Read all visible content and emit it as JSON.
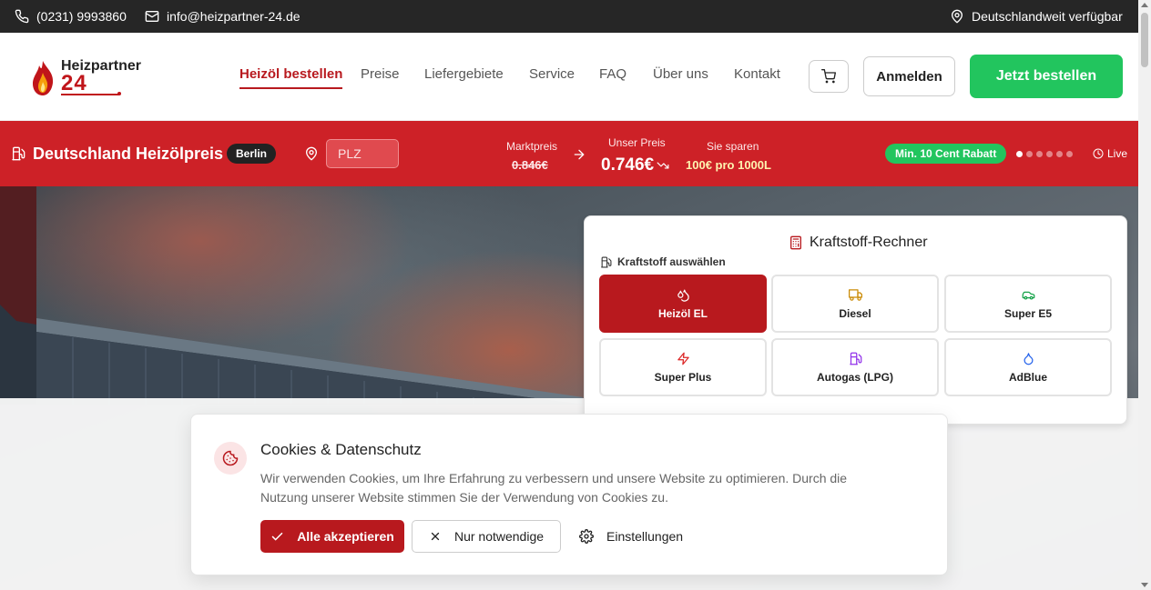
{
  "topbar": {
    "phone": "(0231) 9993860",
    "email": "info@heizpartner-24.de",
    "availability": "Deutschlandweit verfügbar"
  },
  "logo": {
    "name": "Heizpartner",
    "number": "24"
  },
  "nav": {
    "items": [
      "Heizöl bestellen",
      "Preise",
      "Liefergebiete",
      "Service",
      "FAQ",
      "Über uns",
      "Kontakt"
    ],
    "active_index": 0
  },
  "header_actions": {
    "login": "Anmelden",
    "order": "Jetzt bestellen"
  },
  "pricebar": {
    "title": "Deutschland Heizölpreis",
    "city": "Berlin",
    "plz_placeholder": "PLZ",
    "market_label": "Marktpreis",
    "market_price": "0.846€",
    "our_label": "Unser Preis",
    "our_price": "0.746€",
    "save_label": "Sie sparen",
    "save_value": "100€ pro 1000L",
    "discount_badge": "Min. 10 Cent Rabatt",
    "live_label": "Live",
    "slides_total": 6,
    "slide_active": 1
  },
  "calculator": {
    "title": "Kraftstoff-Rechner",
    "select_label": "Kraftstoff auswählen",
    "fuels": [
      "Heizöl EL",
      "Diesel",
      "Super E5",
      "Super Plus",
      "Autogas (LPG)",
      "AdBlue"
    ],
    "selected_index": 0,
    "icon_colors": [
      "#b8191e",
      "#ca8a04",
      "#16a34a",
      "#dc2626",
      "#9333ea",
      "#2563eb"
    ]
  },
  "cookie": {
    "title": "Cookies & Datenschutz",
    "text": "Wir verwenden Cookies, um Ihre Erfahrung zu verbessern und unsere Website zu optimieren. Durch die Nutzung unserer Website stimmen Sie der Verwendung von Cookies zu.",
    "accept_all": "Alle akzeptieren",
    "necessary_only": "Nur notwendige",
    "settings": "Einstellungen"
  },
  "colors": {
    "brand_red": "#cd2127",
    "dark_red": "#b8191e",
    "green": "#22c55e",
    "topbar": "#262626"
  },
  "icons": [
    "phone-icon",
    "mail-icon",
    "map-pin-icon",
    "flame-icon",
    "cart-icon",
    "fuel-pump-icon",
    "location-icon",
    "arrow-right-icon",
    "trending-down-icon",
    "clock-icon",
    "calculator-icon",
    "droplets-icon",
    "truck-icon",
    "car-icon",
    "zap-icon",
    "droplet-icon",
    "cookie-icon",
    "check-icon",
    "x-icon",
    "gear-icon"
  ]
}
